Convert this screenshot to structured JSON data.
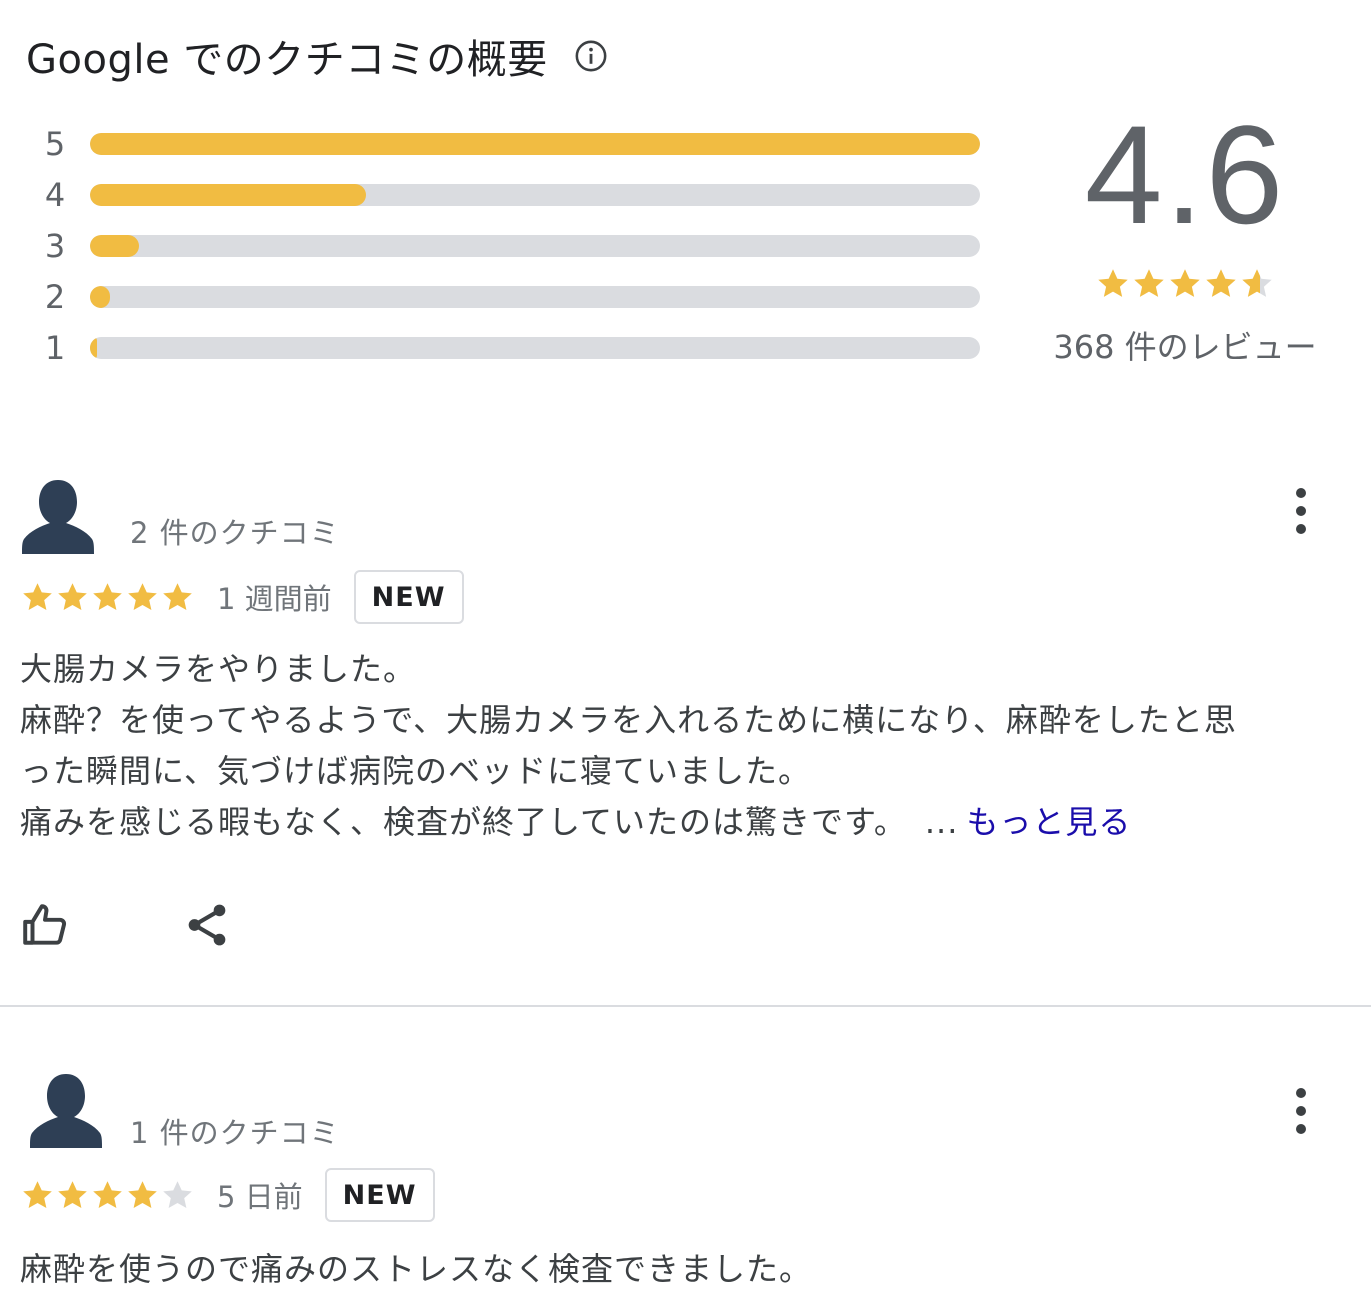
{
  "header": {
    "title": "Google でのクチコミの概要",
    "info_icon": "info-icon"
  },
  "distribution": [
    {
      "label": "5",
      "fraction": 1.0
    },
    {
      "label": "4",
      "fraction": 0.31
    },
    {
      "label": "3",
      "fraction": 0.055
    },
    {
      "label": "2",
      "fraction": 0.022
    },
    {
      "label": "1",
      "fraction": 0.008
    }
  ],
  "summary": {
    "rating": "4.6",
    "stars": 4.6,
    "count_text": "368 件のレビュー"
  },
  "colors": {
    "star": "#f1bc42",
    "star_empty": "#dadce0",
    "link": "#1a0dab",
    "avatar": "#2e3f55"
  },
  "reviews": [
    {
      "author_meta": "2 件のクチコミ",
      "stars": 5,
      "date": "1 週間前",
      "badge": "NEW",
      "lines": [
        "大腸カメラをやりました。",
        "麻酔？を使ってやるようで、大腸カメラを入れるために横になり、麻酔をしたと思",
        "った瞬間に、気づけば病院のベッドに寝ていました。",
        "痛みを感じる暇もなく、検査が終了していたのは驚きです。"
      ],
      "ellipsis": "...",
      "more_link": "もっと見る",
      "like_icon": "thumbs-up-icon",
      "share_icon": "share-icon",
      "menu_icon": "more-vert-icon"
    },
    {
      "author_meta": "1 件のクチコミ",
      "stars": 4,
      "date": "5 日前",
      "badge": "NEW",
      "lines": [
        "麻酔を使うので痛みのストレスなく検査できました。"
      ],
      "menu_icon": "more-vert-icon"
    }
  ]
}
